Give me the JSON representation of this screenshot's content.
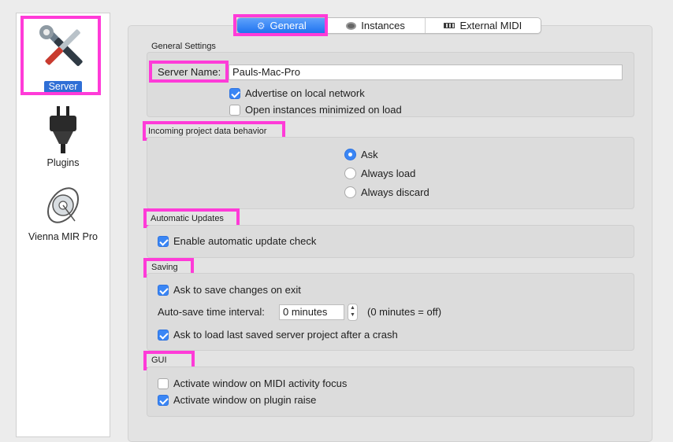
{
  "sidebar": {
    "items": [
      {
        "label": "Server",
        "icon": "wrench-screwdriver-icon",
        "selected": true
      },
      {
        "label": "Plugins",
        "icon": "power-plug-icon",
        "selected": false
      },
      {
        "label": "Vienna MIR Pro",
        "icon": "mir-globe-icon",
        "selected": false
      }
    ]
  },
  "tabs": [
    {
      "label": "General",
      "icon": "gear-icon",
      "selected": true
    },
    {
      "label": "Instances",
      "icon": "instances-icon",
      "selected": false
    },
    {
      "label": "External MIDI",
      "icon": "midi-keyboard-icon",
      "selected": false
    }
  ],
  "general": {
    "title": "General Settings",
    "server_name_label": "Server Name:",
    "server_name_value": "Pauls-Mac-Pro",
    "advertise_label": "Advertise on local network",
    "advertise_checked": true,
    "minimized_label": "Open instances minimized on load",
    "minimized_checked": false
  },
  "incoming": {
    "title": "Incoming project data behavior",
    "options": [
      {
        "label": "Ask",
        "selected": true
      },
      {
        "label": "Always load",
        "selected": false
      },
      {
        "label": "Always discard",
        "selected": false
      }
    ]
  },
  "updates": {
    "title": "Automatic Updates",
    "enable_label": "Enable automatic update check",
    "enable_checked": true
  },
  "saving": {
    "title": "Saving",
    "ask_save_label": "Ask to save changes on exit",
    "ask_save_checked": true,
    "autosave_label": "Auto-save time interval:",
    "autosave_value": "0 minutes",
    "autosave_hint": "(0 minutes = off)",
    "ask_load_label": "Ask to load last saved server project after a crash",
    "ask_load_checked": true
  },
  "gui": {
    "title": "GUI",
    "midi_focus_label": "Activate window on MIDI activity focus",
    "midi_focus_checked": false,
    "plugin_raise_label": "Activate window on plugin raise",
    "plugin_raise_checked": true
  },
  "colors": {
    "highlight": "#ff3bd8",
    "accent": "#3a86f5",
    "selection": "#2f6fd6"
  }
}
